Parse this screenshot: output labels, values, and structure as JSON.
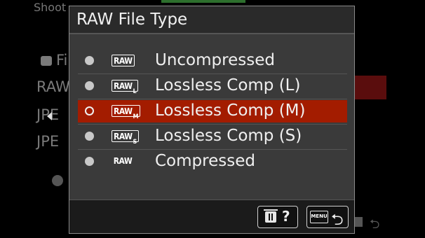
{
  "background": {
    "tab_label": "Shoot",
    "rows": [
      "Fi",
      "RAW",
      "JPE",
      "JPE"
    ]
  },
  "dialog": {
    "title": "RAW File Type",
    "options": [
      {
        "label": "Uncompressed",
        "badge": "RAW",
        "badge_sub": "",
        "boxed": true,
        "selected": false
      },
      {
        "label": "Lossless Comp (L)",
        "badge": "RAW",
        "badge_sub": "L",
        "boxed": true,
        "selected": false
      },
      {
        "label": "Lossless Comp (M)",
        "badge": "RAW",
        "badge_sub": "M",
        "boxed": true,
        "selected": true
      },
      {
        "label": "Lossless Comp (S)",
        "badge": "RAW",
        "badge_sub": "S",
        "boxed": true,
        "selected": false
      },
      {
        "label": "Compressed",
        "badge": "RAW",
        "badge_sub": "",
        "boxed": false,
        "selected": false
      }
    ],
    "footer": {
      "help_label": "?",
      "menu_label": "MENU",
      "back_glyph": "⮌"
    }
  },
  "colors": {
    "selected": "#a31c00",
    "dialog_bg": "#3a3a3a"
  },
  "icons": [
    "camera-icon",
    "trash-icon",
    "help-icon",
    "menu-icon",
    "back-icon",
    "radio-icon"
  ]
}
